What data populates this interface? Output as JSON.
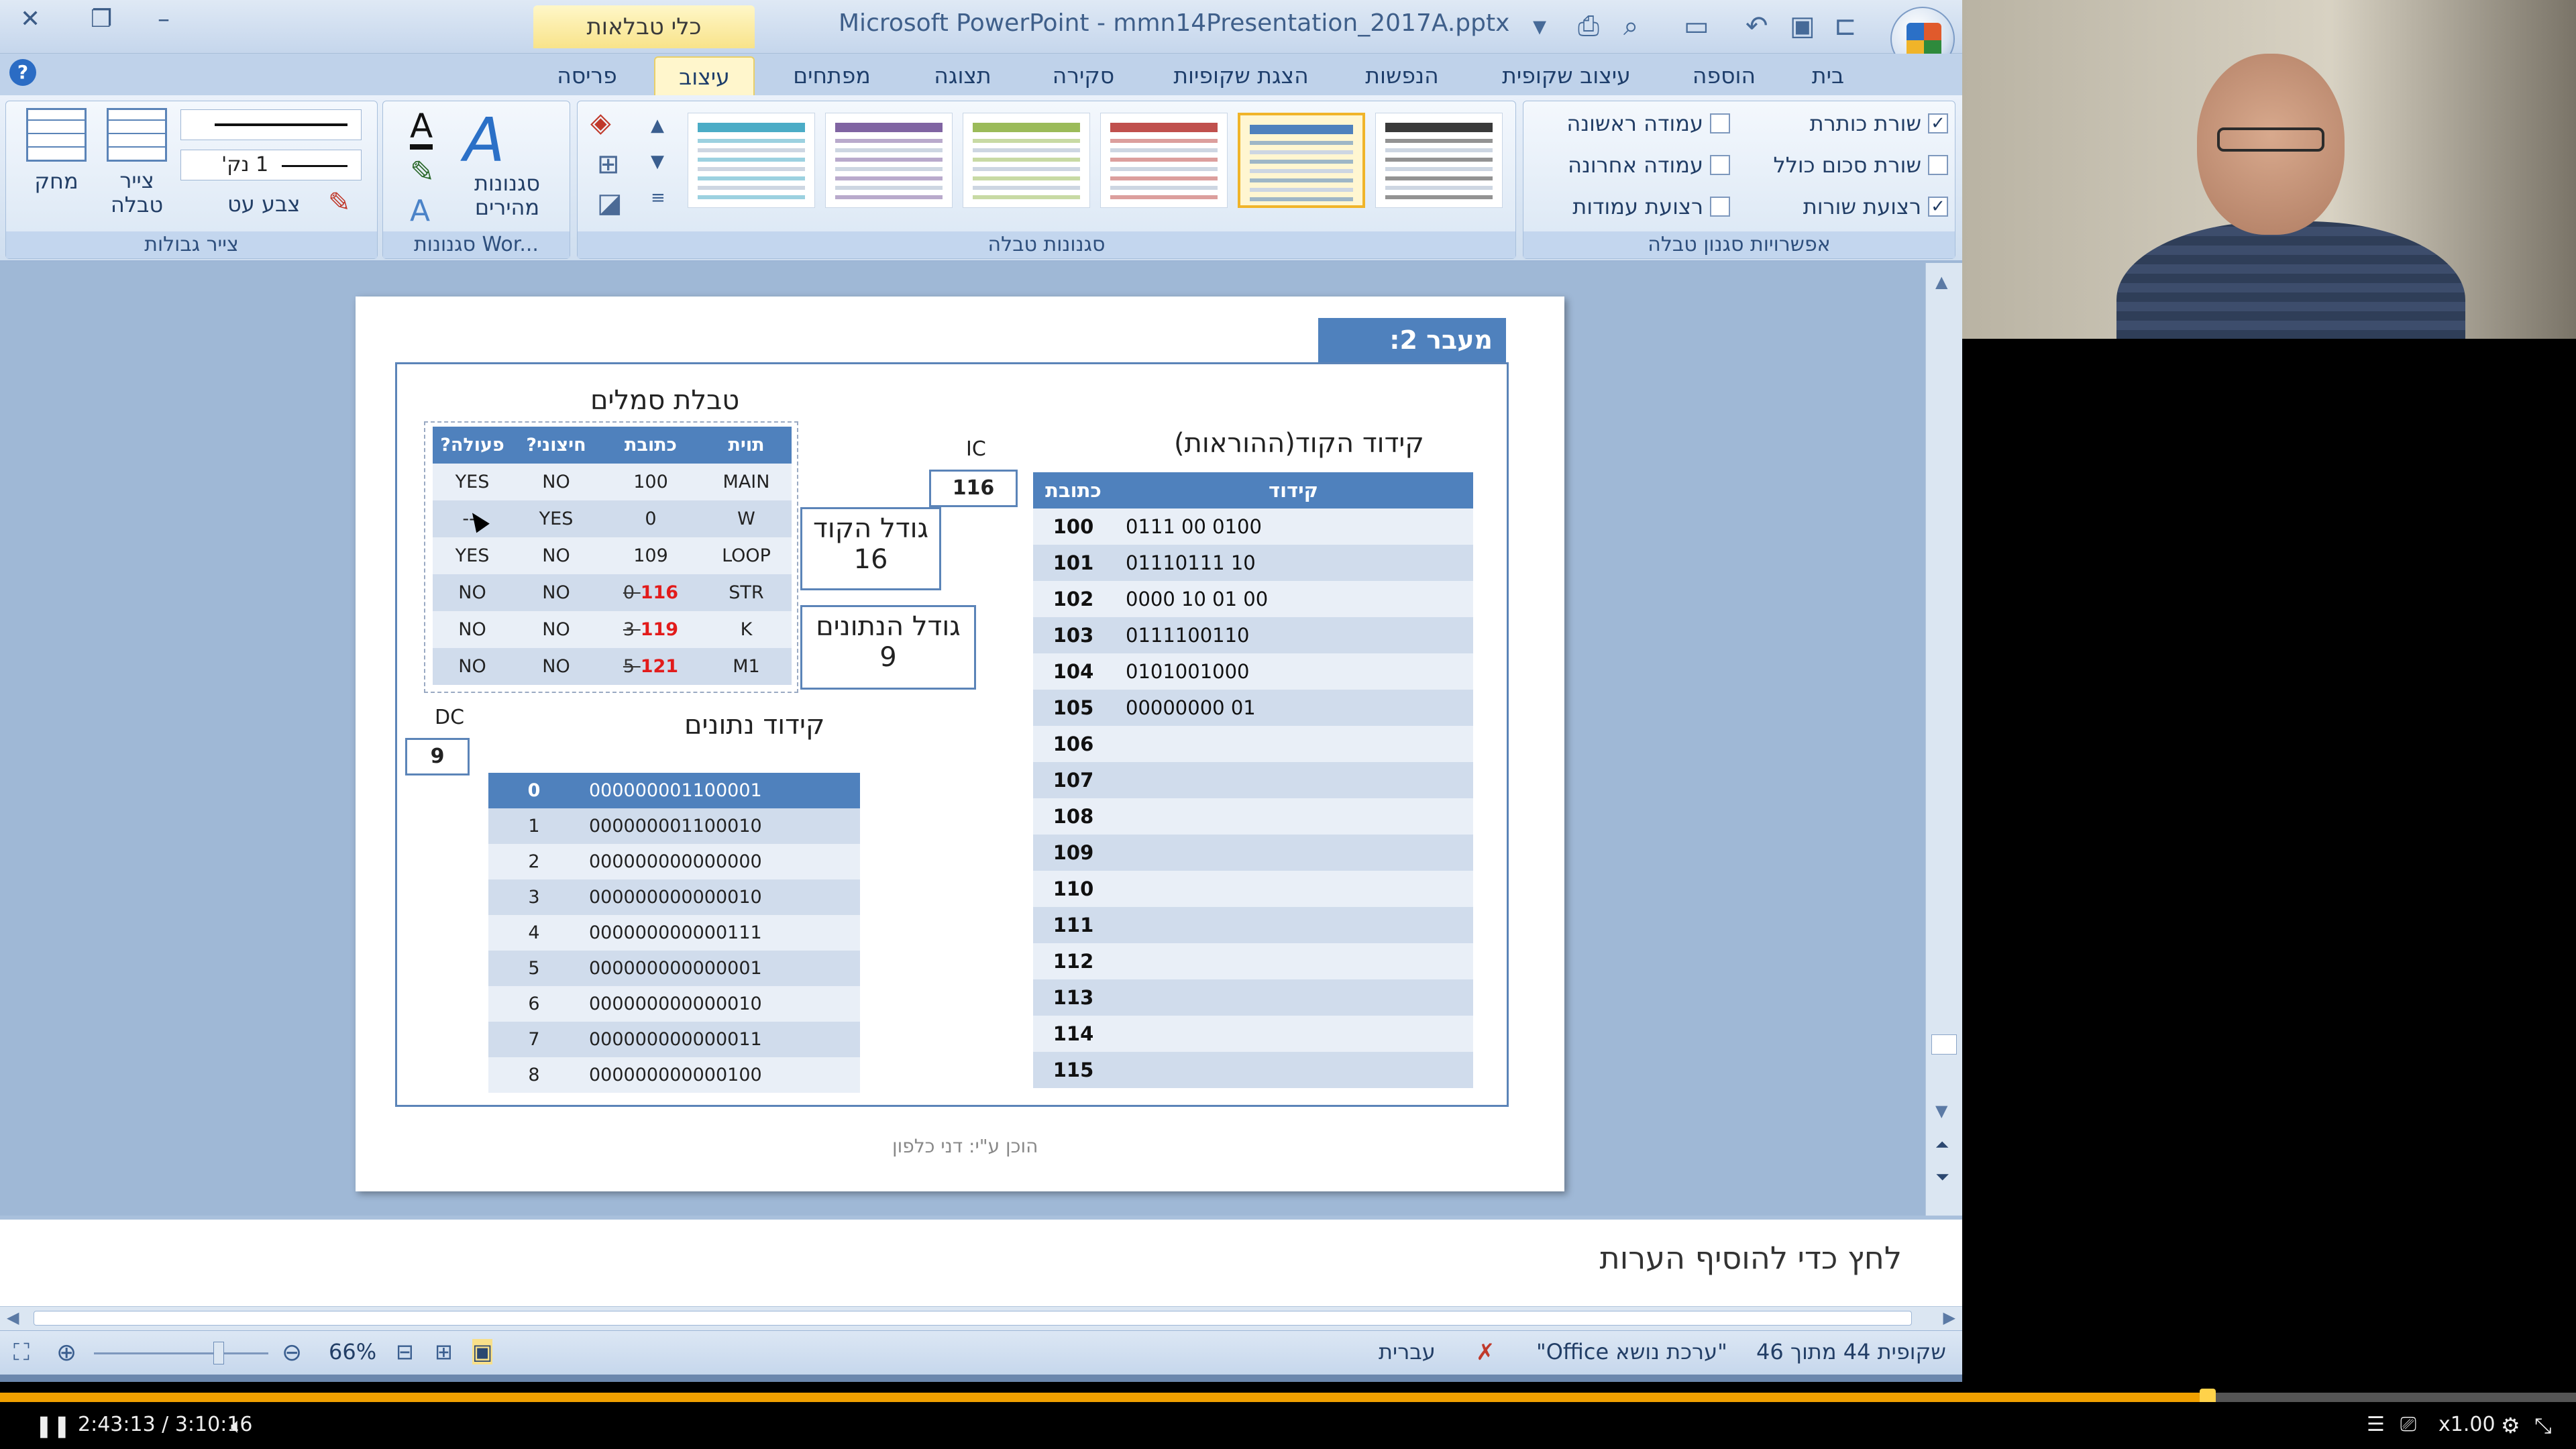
{
  "window": {
    "title": "Microsoft PowerPoint - mmn14Presentation_2017A.pptx",
    "contextual_tab_title": "כלי טבלאות"
  },
  "ribbon": {
    "tabs": [
      "בית",
      "הוספה",
      "עיצוב שקופית",
      "הנפשות",
      "הצגת שקופיות",
      "סקירה",
      "תצוגה",
      "מפתחים",
      "עיצוב",
      "פריסה"
    ],
    "active_tab": "עיצוב",
    "style_options": {
      "label": "אפשרויות סגנון טבלה",
      "items": [
        {
          "label": "שורת כותרת",
          "checked": true
        },
        {
          "label": "עמודה ראשונה",
          "checked": false
        },
        {
          "label": "שורת סכום כולל",
          "checked": false
        },
        {
          "label": "עמודה אחרונה",
          "checked": false
        },
        {
          "label": "רצועת שורות",
          "checked": true
        },
        {
          "label": "רצועת עמודות",
          "checked": false
        }
      ]
    },
    "table_styles": {
      "label": "סגנונות טבלה",
      "swatch_colors": [
        "#3a3a3a",
        "#4f81bd",
        "#c0504d",
        "#9bbb59",
        "#8064a2",
        "#4bacc6"
      ],
      "selected_index": 1
    },
    "wordart": {
      "label": "סגנונות Wor...",
      "quick_styles": "סגנונות מהירים"
    },
    "draw_borders": {
      "label": "צייר גבולות",
      "pen_weight": "1 נק'",
      "pen_color": "צבע עט",
      "draw_table": "צייר טבלה",
      "eraser": "מחק"
    }
  },
  "slide": {
    "title": "מעבר 2:",
    "footer": "הוכן ע\"י: דני כלפון",
    "code_section": {
      "heading": "קידוד הקוד(ההוראות)",
      "columns": [
        "כתובת",
        "קידוד"
      ],
      "rows": [
        {
          "addr": "100",
          "code": "0111 00 0100"
        },
        {
          "addr": "101",
          "code": "01110111 10"
        },
        {
          "addr": "102",
          "code": "0000 10 01 00"
        },
        {
          "addr": "103",
          "code": "0111100110"
        },
        {
          "addr": "104",
          "code": "0101001000"
        },
        {
          "addr": "105",
          "code": "00000000 01"
        },
        {
          "addr": "106",
          "code": ""
        },
        {
          "addr": "107",
          "code": ""
        },
        {
          "addr": "108",
          "code": ""
        },
        {
          "addr": "109",
          "code": ""
        },
        {
          "addr": "110",
          "code": ""
        },
        {
          "addr": "111",
          "code": ""
        },
        {
          "addr": "112",
          "code": ""
        },
        {
          "addr": "113",
          "code": ""
        },
        {
          "addr": "114",
          "code": ""
        },
        {
          "addr": "115",
          "code": ""
        }
      ]
    },
    "ic": {
      "label": "IC",
      "value": "116"
    },
    "dc": {
      "label": "DC",
      "value": "9"
    },
    "code_size": {
      "label": "גודל הקוד",
      "value": "16"
    },
    "data_size": {
      "label": "גודל הנתונים",
      "value": "9"
    },
    "symbol_section": {
      "heading": "טבלת סמלים",
      "columns": [
        "תוית",
        "כתובת",
        "חיצוני?",
        "פעולה?"
      ],
      "rows": [
        {
          "label": "MAIN",
          "old": "",
          "addr": "100",
          "ext": "NO",
          "action": "YES",
          "red": false
        },
        {
          "label": "W",
          "old": "",
          "addr": "0",
          "ext": "YES",
          "action": "---",
          "red": false
        },
        {
          "label": "LOOP",
          "old": "",
          "addr": "109",
          "ext": "NO",
          "action": "YES",
          "red": false
        },
        {
          "label": "STR",
          "old": "0",
          "addr": "116",
          "ext": "NO",
          "action": "NO",
          "red": true
        },
        {
          "label": "K",
          "old": "3",
          "addr": "119",
          "ext": "NO",
          "action": "NO",
          "red": true
        },
        {
          "label": "M1",
          "old": "5",
          "addr": "121",
          "ext": "NO",
          "action": "NO",
          "red": true
        }
      ]
    },
    "data_section": {
      "heading": "קידוד נתונים",
      "rows": [
        {
          "i": "0",
          "v": "000000001100001"
        },
        {
          "i": "1",
          "v": "000000001100010"
        },
        {
          "i": "2",
          "v": "000000000000000"
        },
        {
          "i": "3",
          "v": "000000000000010"
        },
        {
          "i": "4",
          "v": "000000000000111"
        },
        {
          "i": "5",
          "v": "000000000000001"
        },
        {
          "i": "6",
          "v": "000000000000010"
        },
        {
          "i": "7",
          "v": "000000000000011"
        },
        {
          "i": "8",
          "v": "000000000000100"
        }
      ]
    }
  },
  "notes": {
    "placeholder": "לחץ כדי להוסיף הערות"
  },
  "status": {
    "slide_info": "שקופית 44 מתוך 46",
    "theme": "\"ערכת נושא Office\"",
    "language": "עברית",
    "zoom": "66%"
  },
  "player": {
    "time": "2:43:13 / 3:10:16",
    "speed": "x1.00",
    "progress": 0.857
  }
}
